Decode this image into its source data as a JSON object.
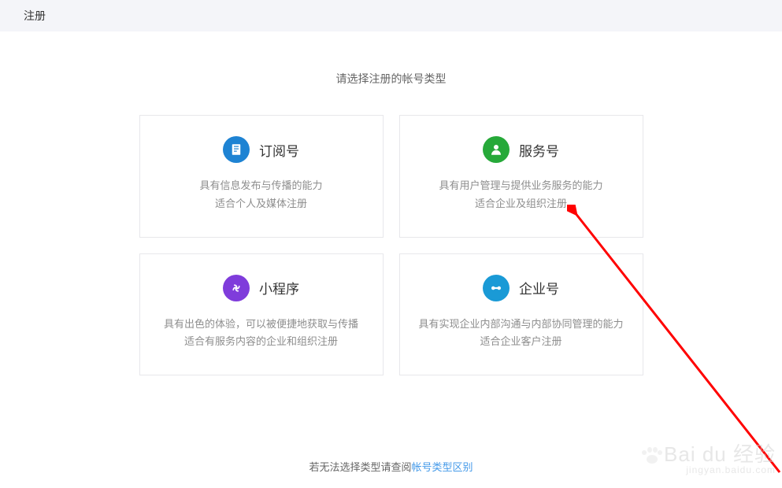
{
  "header": {
    "title": "注册"
  },
  "main": {
    "instruction": "请选择注册的帐号类型",
    "cards": [
      {
        "title": "订阅号",
        "desc_line1": "具有信息发布与传播的能力",
        "desc_line2": "适合个人及媒体注册",
        "icon_color": "#1e83d3",
        "icon_name": "document-icon"
      },
      {
        "title": "服务号",
        "desc_line1": "具有用户管理与提供业务服务的能力",
        "desc_line2": "适合企业及组织注册",
        "icon_color": "#26a939",
        "icon_name": "person-icon"
      },
      {
        "title": "小程序",
        "desc_line1": "具有出色的体验，可以被便捷地获取与传播",
        "desc_line2": "适合有服务内容的企业和组织注册",
        "icon_color": "#7f3cdb",
        "icon_name": "mini-program-icon"
      },
      {
        "title": "企业号",
        "desc_line1": "具有实现企业内部沟通与内部协同管理的能力",
        "desc_line2": "适合企业客户注册",
        "icon_color": "#1a9ad6",
        "icon_name": "enterprise-icon"
      }
    ]
  },
  "footer": {
    "prefix": "若无法选择类型请查阅",
    "link_text": "帐号类型区别"
  },
  "annotation": {
    "arrow_color": "#ff0000"
  },
  "watermark": {
    "main": "Bai du 经验",
    "sub": "jingyan.baidu.com"
  }
}
